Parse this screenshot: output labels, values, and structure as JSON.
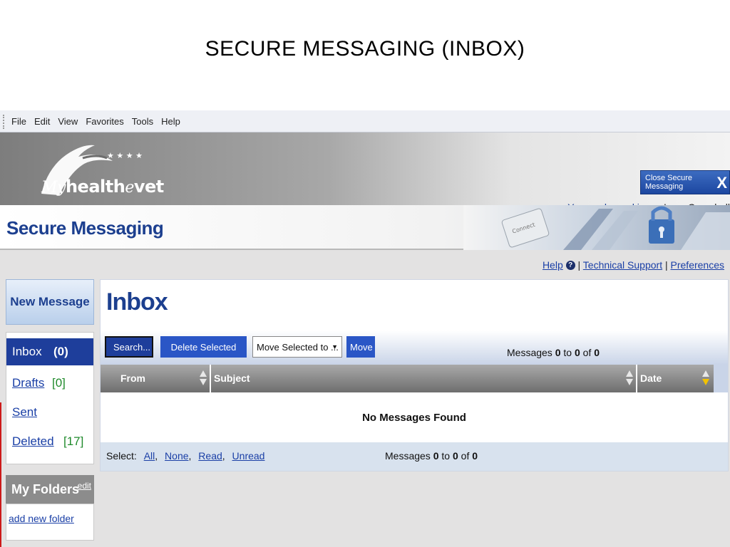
{
  "slide": {
    "title": "SECURE MESSAGING (INBOX)"
  },
  "menu": [
    "File",
    "Edit",
    "View",
    "Favorites",
    "Tools",
    "Help"
  ],
  "header": {
    "logo_my": "My",
    "logo_health": "health",
    "logo_e": "e",
    "logo_vet": "vet",
    "close_label": "Close Secure Messaging",
    "close_x": "X",
    "logged_in_prefix": "You are logged in as:",
    "user": "Lynn Campbell"
  },
  "banner": {
    "title": "Secure Messaging"
  },
  "links": {
    "help": "Help",
    "help_icon": "?",
    "sep1": "|",
    "technical_support": "Technical Support",
    "sep2": "|",
    "preferences": "Preferences"
  },
  "sidebar": {
    "new_message": "New Message",
    "folders": [
      {
        "label": "Inbox",
        "count": "(0)"
      },
      {
        "label": "Drafts",
        "count": "[0]"
      },
      {
        "label": "Sent",
        "count": ""
      },
      {
        "label": "Deleted",
        "count": "[17]"
      }
    ],
    "my_folders": "My Folders",
    "edit": "edit",
    "add_new_folder": "add new folder"
  },
  "main": {
    "title": "Inbox",
    "search": "Search...",
    "delete_selected": "Delete Selected",
    "move_select": "Move Selected to ...",
    "move": "Move",
    "messages_prefix": "Messages",
    "from_n": "0",
    "to_word": "to",
    "to_n": "0",
    "of_word": "of",
    "total": "0",
    "columns": {
      "from": "From",
      "subject": "Subject",
      "date": "Date"
    },
    "empty": "No Messages Found",
    "select_label": "Select:",
    "select_all": "All",
    "select_none": "None",
    "select_read": "Read",
    "select_unread": "Unread"
  },
  "colors": {
    "accent_blue": "#1e3e9b",
    "link": "#1a3fa6",
    "count_green": "#1f8a2b",
    "sort_active": "#f2c200"
  }
}
